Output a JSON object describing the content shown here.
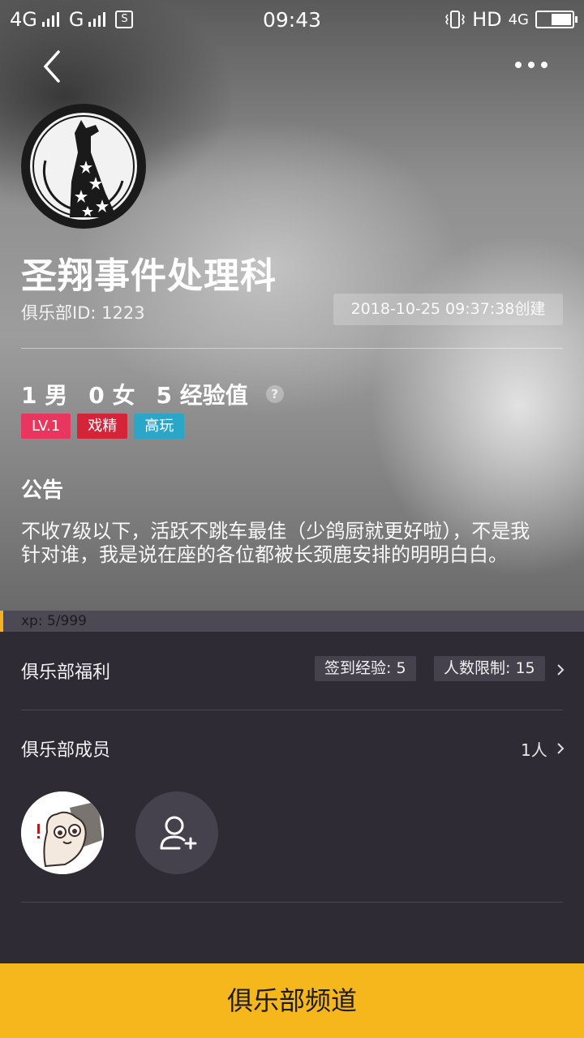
{
  "status_bar": {
    "network1": "4G",
    "network2": "G",
    "time": "09:43",
    "hd": "HD",
    "network3": "4G"
  },
  "club": {
    "name": "圣翔事件处理科",
    "id_text": "俱乐部ID: 1223",
    "created": "2018-10-25 09:37:38创建",
    "stats": {
      "male": "1 男",
      "female": "0 女",
      "exp": "5 经验值",
      "help": "?"
    },
    "tags": [
      {
        "label": "LV.1",
        "color": "#e9365e"
      },
      {
        "label": "戏精",
        "color": "#d4243a"
      },
      {
        "label": "高玩",
        "color": "#2aa6c8"
      }
    ],
    "notice_title": "公告",
    "notice_text": "不收7级以下，活跃不跳车最佳（少鸽厨就更好啦），不是我针对谁，我是说在座的各位都被长颈鹿安排的明明白白。"
  },
  "xp": {
    "text": "xp: 5/999",
    "fraction": 0.005,
    "color": "#f2b41e"
  },
  "benefits": {
    "title": "俱乐部福利",
    "sign_in": "签到经验: 5",
    "limit": "人数限制: 15"
  },
  "members": {
    "title": "俱乐部成员",
    "count": "1人"
  },
  "channel_button": "俱乐部频道",
  "icons": [
    "back-arrow-icon",
    "more-dots-icon",
    "giraffe-logo",
    "help-icon",
    "chevron-right-icon",
    "add-member-icon"
  ]
}
